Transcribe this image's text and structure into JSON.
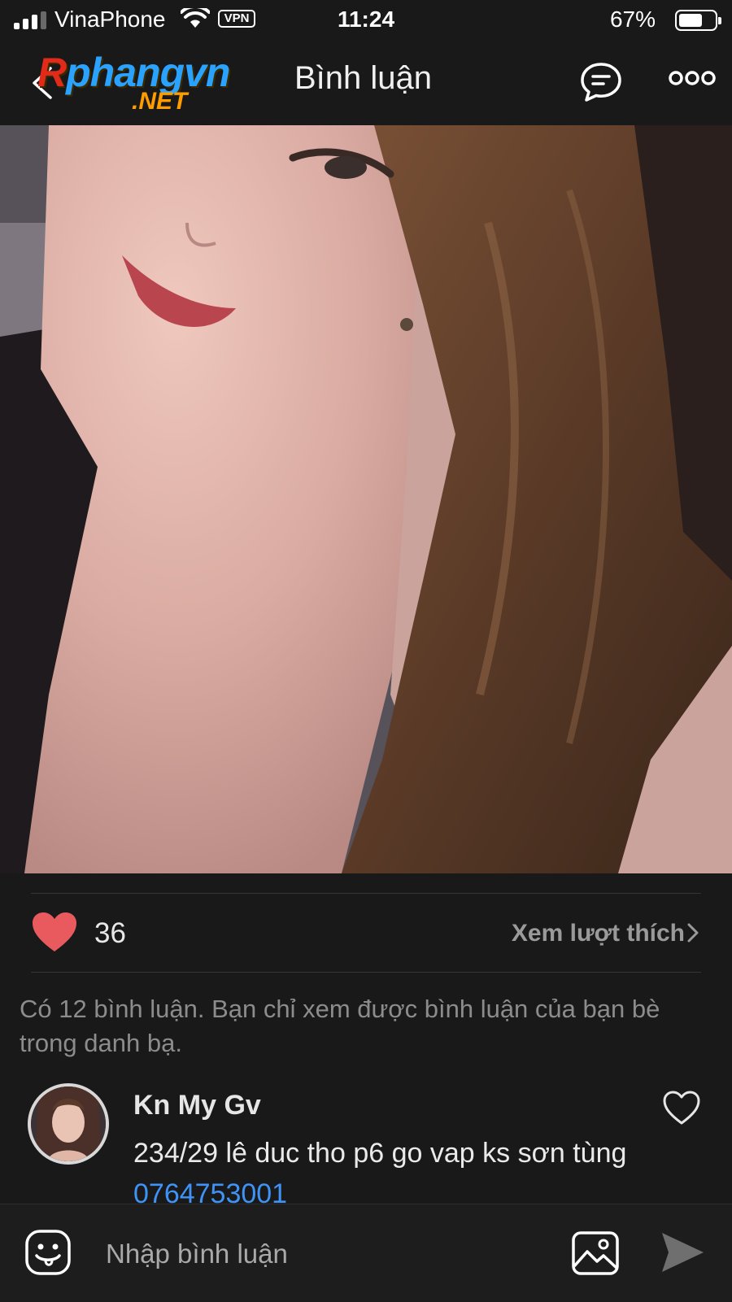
{
  "status_bar": {
    "carrier": "VinaPhone",
    "vpn": "VPN",
    "time": "11:24",
    "battery_percent": "67%",
    "battery_level": 0.67,
    "signal_bars": 3
  },
  "nav": {
    "logo_main": "Rphangvn",
    "logo_sub": ".NET",
    "title": "Bình luận",
    "icons": [
      "back-icon",
      "chat-icon",
      "more-icon"
    ]
  },
  "post": {
    "like_count": "36",
    "view_likes_label": "Xem lượt thích"
  },
  "notice": "Có 12 bình luận. Bạn chỉ xem được bình luận của bạn bè trong danh bạ.",
  "comments": [
    {
      "author": "Kn My Gv",
      "text": "234/29 lê duc tho p6 go vap ks sơn tùng ",
      "phone": "0764753001"
    }
  ],
  "input_bar": {
    "placeholder": "Nhập bình luận",
    "icons": [
      "emoji-icon",
      "image-icon",
      "send-icon"
    ]
  },
  "colors": {
    "background": "#191919",
    "like_heart": "#e95a5f",
    "link": "#3f93f7",
    "muted_text": "#8c8c8c"
  }
}
